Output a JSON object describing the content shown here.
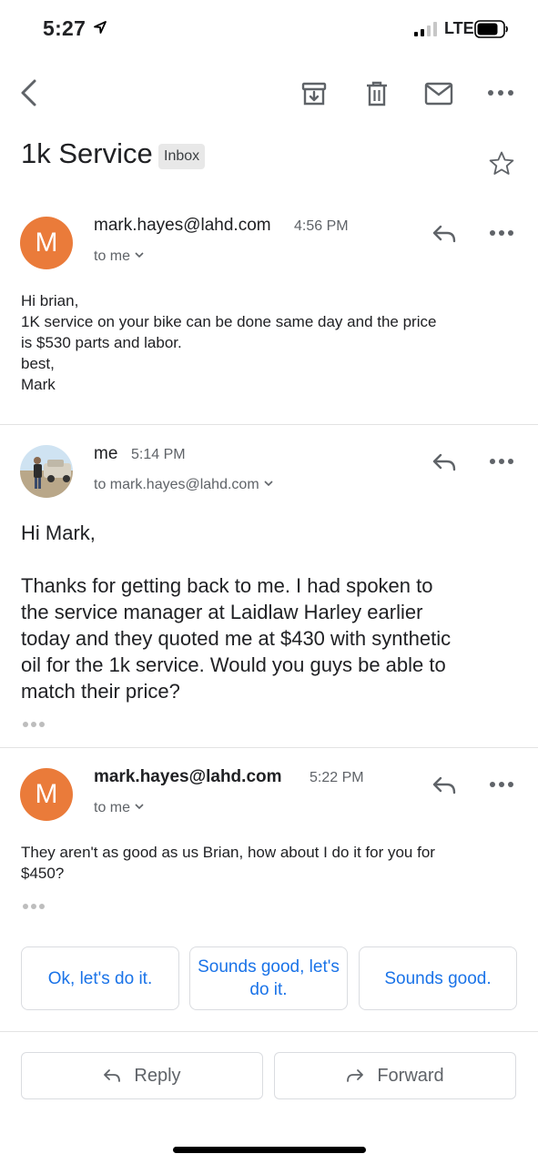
{
  "status_bar": {
    "time": "5:27",
    "carrier": "LTE"
  },
  "toolbar": {
    "icons": [
      "back-icon",
      "archive-icon",
      "trash-icon",
      "mail-icon",
      "more-icon"
    ]
  },
  "subject": {
    "title": "1k Service",
    "label": "Inbox"
  },
  "messages": [
    {
      "sender": "mark.hayes@lahd.com",
      "avatar_letter": "M",
      "time": "4:56 PM",
      "recipient": "to me",
      "body": "Hi brian,\n1K service on your bike can be done same day and the price\nis $530 parts and labor.\nbest,\nMark"
    },
    {
      "sender": "me",
      "time": "5:14 PM",
      "recipient": "to mark.hayes@lahd.com",
      "body": "Hi Mark,\n\nThanks for getting back to me. I had spoken to\nthe service manager at Laidlaw Harley earlier\ntoday and they quoted me at $430 with synthetic\noil for the 1k service. Would you guys be able to\nmatch their price?"
    },
    {
      "sender": "mark.hayes@lahd.com",
      "avatar_letter": "M",
      "time": "5:22 PM",
      "recipient": "to me",
      "body": "They aren't as good as us Brian, how about I do it for you for\n$450?"
    }
  ],
  "smart_replies": [
    "Ok, let's do it.",
    "Sounds good, let's do it.",
    "Sounds good."
  ],
  "actions": {
    "reply": "Reply",
    "forward": "Forward"
  },
  "colors": {
    "avatar": "#ea7b3a",
    "accent": "#1a73e8"
  }
}
